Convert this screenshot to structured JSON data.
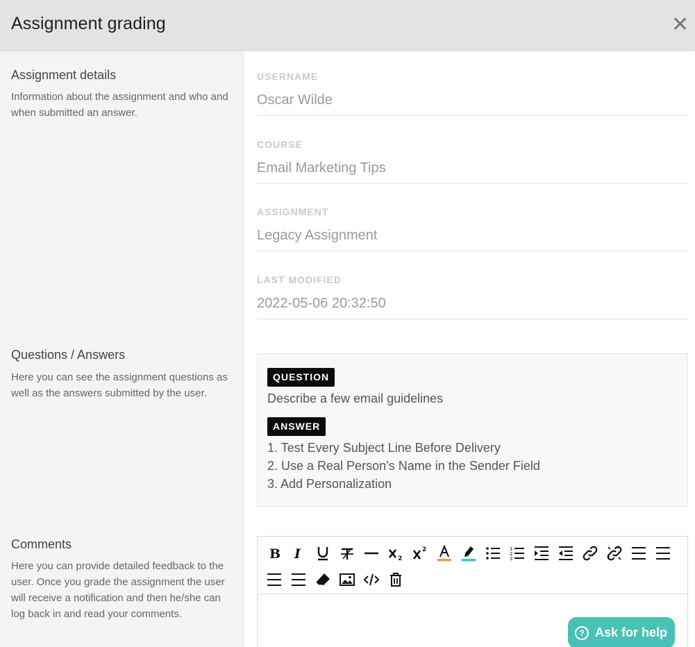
{
  "header": {
    "title": "Assignment grading",
    "close_glyph": "✕"
  },
  "details": {
    "title": "Assignment details",
    "description": "Information about the assignment and who and when submitted an answer.",
    "fields": [
      {
        "label": "USERNAME",
        "value": "Oscar Wilde"
      },
      {
        "label": "COURSE",
        "value": "Email Marketing Tips"
      },
      {
        "label": "ASSIGNMENT",
        "value": "Legacy Assignment"
      },
      {
        "label": "LAST MODIFIED",
        "value": "2022-05-06 20:32:50"
      }
    ]
  },
  "qa": {
    "title": "Questions / Answers",
    "description": "Here you can see the assignment questions as well as the answers submitted by the user.",
    "question_tag": "QUESTION",
    "question": "Describe a few email guidelines",
    "answer_tag": "ANSWER",
    "answer_lines": [
      "1. Test Every Subject Line Before Delivery",
      "2. Use a Real Person’s Name in the Sender Field",
      "3. Add Personalization"
    ]
  },
  "comments": {
    "title": "Comments",
    "description": "Here you can provide detailed feedback to the user. Once you grade the assignment the user will receive a notification and then he/she can log back in and read your comments.",
    "toolbar_icons": [
      "bold-icon",
      "italic-icon",
      "underline-icon",
      "strikethrough-icon",
      "horizontal-rule-icon",
      "subscript-icon",
      "superscript-icon",
      "font-color-icon",
      "highlight-icon",
      "bullet-list-icon",
      "numbered-list-icon",
      "indent-icon",
      "outdent-icon",
      "link-icon",
      "unlink-icon",
      "align-left-icon",
      "align-center-icon",
      "align-right-icon",
      "justify-icon",
      "eraser-icon",
      "image-icon",
      "code-icon",
      "trash-icon"
    ],
    "font_color_accent": "#e0a24c",
    "highlight_accent": "#3fc1c9"
  },
  "help": {
    "label": "Ask for help",
    "glyph": "?",
    "color": "#48c2b6"
  }
}
